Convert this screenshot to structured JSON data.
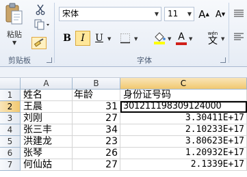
{
  "ribbon": {
    "clipboard": {
      "paste_label": "粘贴",
      "group_label": "剪贴板",
      "icons": [
        "paste-icon",
        "cut-icon",
        "copy-icon",
        "format-painter-icon"
      ]
    },
    "font": {
      "group_label": "字体",
      "font_name": "宋体",
      "font_size": "11",
      "grow_label": "A",
      "shrink_label": "A",
      "bold_label": "B",
      "italic_label": "I",
      "underline_label": "U",
      "font_color_label": "A",
      "wen_label": "wén",
      "wen_char": "文",
      "italic_active": true,
      "accent_fill": "#ffe79a",
      "font_color": "#d0201a",
      "highlight_color": "#ffff00"
    }
  },
  "sheet": {
    "columns": [
      "A",
      "B",
      "C"
    ],
    "selected_column": "C",
    "selected_row": "2",
    "rows": [
      {
        "row": "1",
        "a": "姓名",
        "b": "年龄",
        "c": "身份证号码"
      },
      {
        "row": "2",
        "a": "王晨",
        "b": "31",
        "c": "301211198309124000"
      },
      {
        "row": "3",
        "a": "刘刚",
        "b": "27",
        "c": "3.30411E+17"
      },
      {
        "row": "4",
        "a": "张三丰",
        "b": "34",
        "c": "2.10233E+17"
      },
      {
        "row": "5",
        "a": "洪建龙",
        "b": "23",
        "c": "3.80623E+17"
      },
      {
        "row": "6",
        "a": "张琴",
        "b": "26",
        "c": "1.20932E+17"
      },
      {
        "row": "7",
        "a": "何仙姑",
        "b": "27",
        "c": "2.1339E+17"
      }
    ]
  }
}
